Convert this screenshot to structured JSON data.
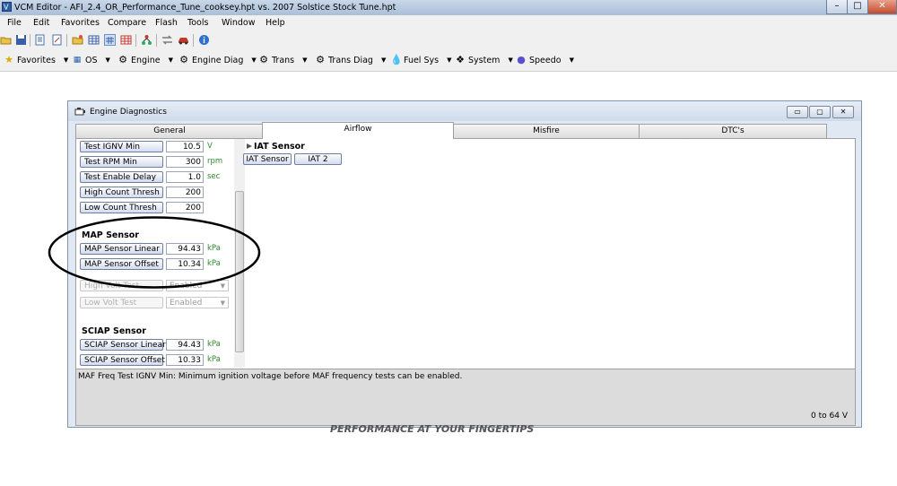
{
  "window": {
    "title": "VCM Editor - AFI_2.4_OR_Performance_Tune_cooksey.hpt  vs.  2007 Solstice Stock Tune.hpt",
    "controls": {
      "minimize": "–",
      "maximize": "□",
      "close": "✕"
    }
  },
  "menu": [
    "File",
    "Edit",
    "Favorites",
    "Compare",
    "Flash",
    "Tools",
    "Window",
    "Help"
  ],
  "toolbar2": [
    {
      "label": "Favorites",
      "icon": "star-icon"
    },
    {
      "label": "OS",
      "icon": "chip-icon"
    },
    {
      "label": "Engine",
      "icon": "engine-icon"
    },
    {
      "label": "Engine Diag",
      "icon": "engine-diag-icon"
    },
    {
      "label": "Trans",
      "icon": "gear-icon"
    },
    {
      "label": "Trans Diag",
      "icon": "trans-diag-icon"
    },
    {
      "label": "Fuel Sys",
      "icon": "fuel-drop-icon"
    },
    {
      "label": "System",
      "icon": "system-icon"
    },
    {
      "label": "Speedo",
      "icon": "speedo-icon"
    }
  ],
  "dialog": {
    "title": "Engine Diagnostics",
    "controls": {
      "minimize": "▭",
      "restore": "▢",
      "close": "✕"
    },
    "tabs": [
      "General",
      "Airflow",
      "Misfire",
      "DTC's"
    ],
    "active_tab": "Airflow",
    "params_top": [
      {
        "label": "Test IGNV Min",
        "value": "10.5",
        "unit": "V"
      },
      {
        "label": "Test RPM Min",
        "value": "300",
        "unit": "rpm"
      },
      {
        "label": "Test Enable Delay",
        "value": "1.0",
        "unit": "sec"
      },
      {
        "label": "High Count Thresh",
        "value": "200",
        "unit": ""
      },
      {
        "label": "Low Count Thresh",
        "value": "200",
        "unit": ""
      }
    ],
    "map_section": "MAP Sensor",
    "map_params": [
      {
        "label": "MAP Sensor Linear",
        "value": "94.43",
        "unit": "kPa"
      },
      {
        "label": "MAP Sensor Offset",
        "value": "10.34",
        "unit": "kPa"
      }
    ],
    "disabled_params": [
      {
        "label": "High Volt Test",
        "value": "Enabled"
      },
      {
        "label": "Low Volt Test",
        "value": "Enabled"
      }
    ],
    "sciap_section": "SCIAP Sensor",
    "sciap_params": [
      {
        "label": "SCIAP Sensor Linear",
        "value": "94.43",
        "unit": "kPa"
      },
      {
        "label": "SCIAP Sensor Offset",
        "value": "10.33",
        "unit": "kPa"
      }
    ],
    "iat_section": "IAT Sensor",
    "iat_buttons": [
      "IAT Sensor",
      "IAT 2"
    ],
    "description": "MAF Freq Test IGNV Min: Minimum ignition voltage before MAF frequency tests can be enabled.",
    "range": "0 to 64 V"
  },
  "footer_text": "PERFORMANCE AT YOUR FINGERTIPS",
  "colors": {
    "unit_text": "#2e8b2e",
    "annotation_ellipse": "#000000",
    "dialog_bg": "#dfe8f3"
  }
}
